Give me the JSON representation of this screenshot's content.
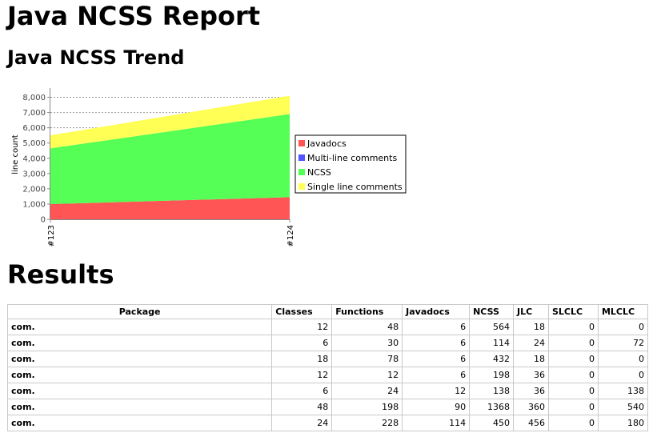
{
  "page": {
    "title": "Java NCSS Report",
    "trend_heading": "Java NCSS Trend",
    "results_heading": "Results"
  },
  "chart_data": {
    "type": "area",
    "stacked": true,
    "title": "",
    "xlabel": "",
    "ylabel": "line count",
    "categories": [
      "#123",
      "#124"
    ],
    "ylim": [
      0,
      8500
    ],
    "yticks": [
      0,
      1000,
      2000,
      3000,
      4000,
      5000,
      6000,
      7000,
      8000
    ],
    "ytick_labels": [
      "0",
      "1,000",
      "2,000",
      "3,000",
      "4,000",
      "5,000",
      "6,000",
      "7,000",
      "8,000"
    ],
    "legend_position": "right",
    "grid": true,
    "series": [
      {
        "name": "Javadocs",
        "color": "#ff5555",
        "values": [
          1000,
          1450
        ]
      },
      {
        "name": "Multi-line comments",
        "color": "#5555ff",
        "values": [
          0,
          0
        ]
      },
      {
        "name": "NCSS",
        "color": "#55ff55",
        "values": [
          3650,
          5450
        ]
      },
      {
        "name": "Single line comments",
        "color": "#ffff55",
        "values": [
          850,
          1200
        ]
      }
    ]
  },
  "results": {
    "headers": [
      "Package",
      "Classes",
      "Functions",
      "Javadocs",
      "NCSS",
      "JLC",
      "SLCLC",
      "MLCLC"
    ],
    "rows": [
      [
        "com.",
        "12",
        "48",
        "6",
        "564",
        "18",
        "0",
        "0"
      ],
      [
        "com.",
        "6",
        "30",
        "6",
        "114",
        "24",
        "0",
        "72"
      ],
      [
        "com.",
        "18",
        "78",
        "6",
        "432",
        "18",
        "0",
        "0"
      ],
      [
        "com.",
        "12",
        "12",
        "6",
        "198",
        "36",
        "0",
        "0"
      ],
      [
        "com.",
        "6",
        "24",
        "12",
        "138",
        "36",
        "0",
        "138"
      ],
      [
        "com.",
        "48",
        "198",
        "90",
        "1368",
        "360",
        "0",
        "540"
      ],
      [
        "com.",
        "24",
        "228",
        "114",
        "450",
        "456",
        "0",
        "180"
      ]
    ]
  }
}
